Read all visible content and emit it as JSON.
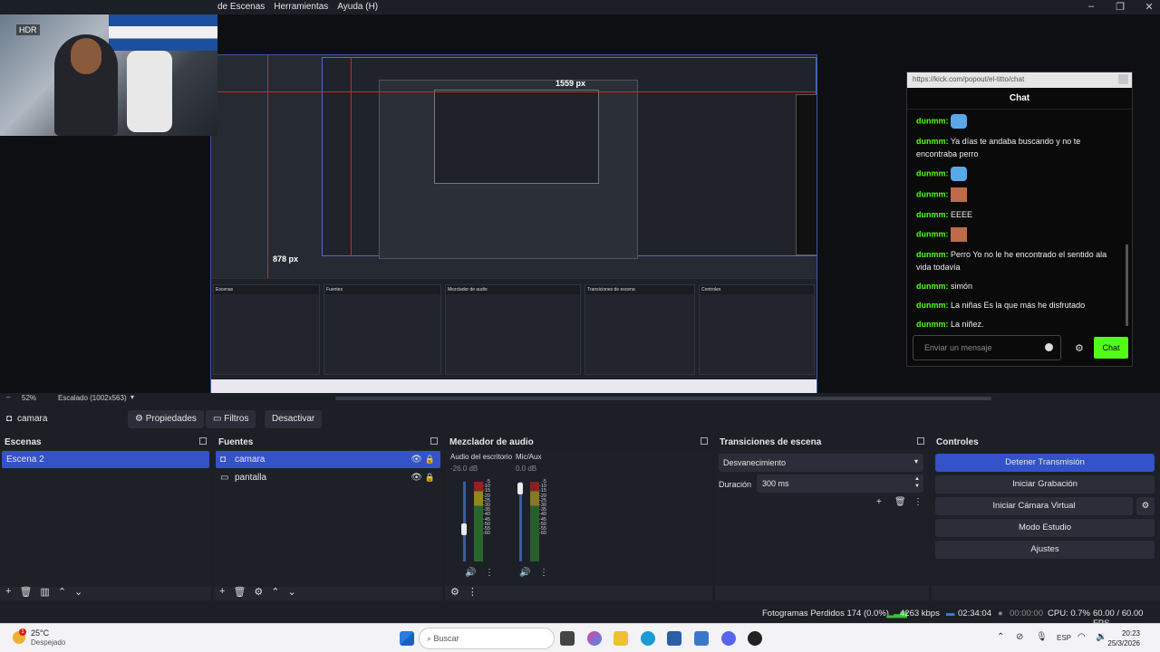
{
  "menu": {
    "items": [
      "de Escenas",
      "Herramientas",
      "Ayuda (H)"
    ]
  },
  "window_controls": {
    "minimize": "–",
    "maximize": "❐",
    "close": "✕"
  },
  "preview": {
    "webcam_badge": "HDR",
    "nested_width_label": "1559 px",
    "nested_height_label": "878 px"
  },
  "chat": {
    "url": "https://kick.com/popout/el-titto/chat",
    "title": "Chat",
    "messages": [
      {
        "user": "dunmm:",
        "text": "",
        "emote": "bird"
      },
      {
        "user": "dunmm:",
        "text": "Ya días te andaba buscando y no te encontraba perro",
        "emote": ""
      },
      {
        "user": "dunmm:",
        "text": "",
        "emote": "bird"
      },
      {
        "user": "dunmm:",
        "text": "",
        "emote": "face"
      },
      {
        "user": "dunmm:",
        "text": "EEEE",
        "emote": ""
      },
      {
        "user": "dunmm:",
        "text": "",
        "emote": "face"
      },
      {
        "user": "dunmm:",
        "text": "Perro Yo no le he encontrado el sentido ala vida todavía",
        "emote": ""
      },
      {
        "user": "dunmm:",
        "text": "simón",
        "emote": ""
      },
      {
        "user": "dunmm:",
        "text": "La niñas Es la que más he disfrutado",
        "emote": ""
      },
      {
        "user": "dunmm:",
        "text": "La niñez.",
        "emote": ""
      }
    ],
    "input_placeholder": "Enviar un mensaje",
    "send_label": "Chat",
    "accent": "#53fc18"
  },
  "scalebar": {
    "zoom": "52%",
    "scaling": "Escalado (1002x563)"
  },
  "context": {
    "source_name": "camara",
    "properties": "Propiedades",
    "filters": "Filtros",
    "deactivate": "Desactivar"
  },
  "scenes": {
    "title": "Escenas",
    "items": [
      {
        "name": "Escena 2",
        "selected": true
      }
    ]
  },
  "sources": {
    "title": "Fuentes",
    "items": [
      {
        "name": "camara",
        "icon": "camera-icon",
        "selected": true
      },
      {
        "name": "pantalla",
        "icon": "monitor-icon",
        "selected": false
      }
    ]
  },
  "mixer": {
    "title": "Mezclador de audio",
    "channels": [
      {
        "name": "Audio del escritorio",
        "db": "-26.0 dB",
        "level": 0.35
      },
      {
        "name": "Mic/Aux",
        "db": "0.0 dB",
        "level": 0.25
      }
    ],
    "ticks": [
      "-5",
      "-10",
      "-15",
      "-20",
      "-25",
      "-30",
      "-35",
      "-40",
      "-45",
      "-50",
      "-55",
      "-60"
    ]
  },
  "transitions": {
    "title": "Transiciones de escena",
    "selected": "Desvanecimiento",
    "duration_label": "Duración",
    "duration_value": "300 ms"
  },
  "controls": {
    "title": "Controles",
    "stop_stream": "Detener Transmisión",
    "start_record": "Iniciar Grabación",
    "start_virtualcam": "Iniciar Cámara Virtual",
    "studio_mode": "Modo Estudio",
    "settings": "Ajustes",
    "accent": "#3453c8"
  },
  "status": {
    "dropped": "Fotogramas Perdidos 174 (0.0%)",
    "bitrate": "4263 kbps",
    "stream_time": "02:34:04",
    "record_time": "00:00:00",
    "cpu": "CPU: 0.7%",
    "fps": "60.00 / 60.00 FPS"
  },
  "taskbar": {
    "weather_temp": "25°C",
    "weather_desc": "Despejado",
    "weather_badge": "1",
    "search_placeholder": "Buscar",
    "lang": "ESP",
    "time": "20:23",
    "date": "25/3/2026"
  }
}
